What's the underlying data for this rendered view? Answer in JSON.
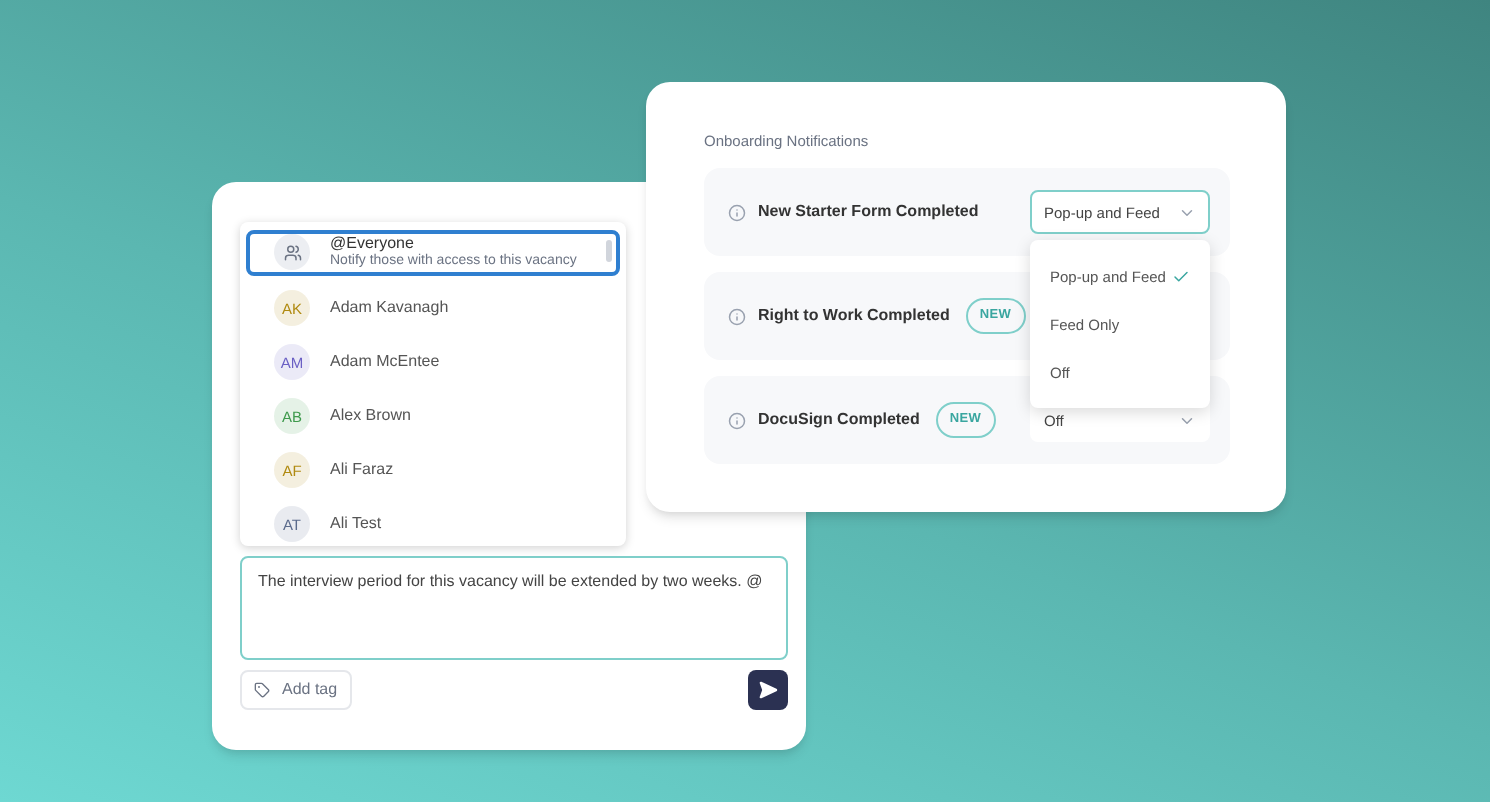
{
  "notifications": {
    "title": "Onboarding Notifications",
    "rows": [
      {
        "label": "New Starter Form Completed",
        "value": "Pop-up and Feed",
        "open": true,
        "options": [
          {
            "label": "Pop-up and Feed",
            "selected": true
          },
          {
            "label": "Feed Only",
            "selected": false
          },
          {
            "label": "Off",
            "selected": false
          }
        ]
      },
      {
        "label": "Right to Work Completed",
        "badge": "NEW"
      },
      {
        "label": "DocuSign Completed",
        "badge": "NEW",
        "value": "Off",
        "open": false
      }
    ]
  },
  "mentions": [
    {
      "kind": "group",
      "name": "@Everyone",
      "description": "Notify those with access to this vacancy",
      "selected": true
    },
    {
      "kind": "person",
      "initials": "AK",
      "name": "Adam Kavanagh",
      "color": "#b08a10",
      "selected": false
    },
    {
      "kind": "person",
      "initials": "AM",
      "name": "Adam McEntee",
      "color": "#6a5fc4",
      "selected": false
    },
    {
      "kind": "person",
      "initials": "AB",
      "name": "Alex Brown",
      "color": "#3e9a4c",
      "selected": false
    },
    {
      "kind": "person",
      "initials": "AF",
      "name": "Ali Faraz",
      "color": "#b08a10",
      "selected": false
    },
    {
      "kind": "person",
      "initials": "AT",
      "name": "Ali Test",
      "color": "#5b6b8c",
      "selected": false
    }
  ],
  "composer": {
    "value": "The interview period for this vacancy will be extended by two weeks. @",
    "add_tag": "Add tag"
  }
}
